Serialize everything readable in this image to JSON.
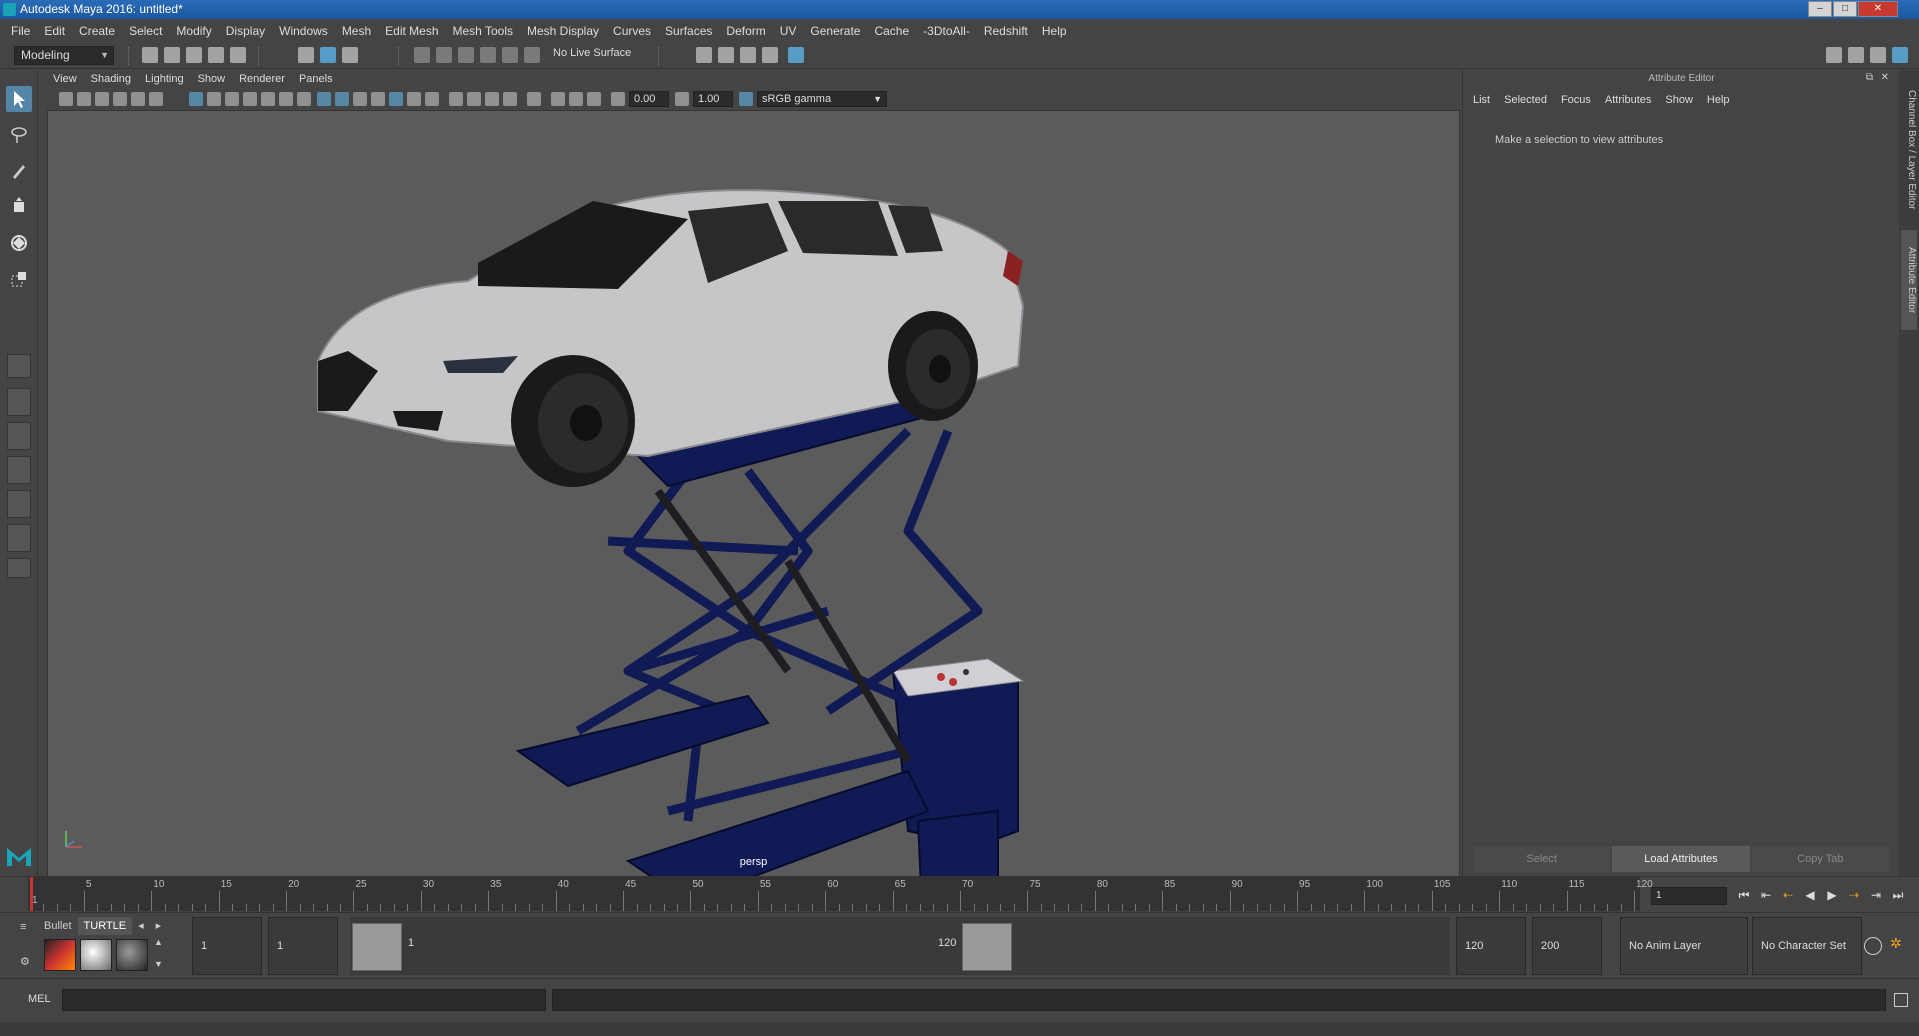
{
  "window": {
    "title": "Autodesk Maya 2016: untitled*"
  },
  "menubar": [
    "File",
    "Edit",
    "Create",
    "Select",
    "Modify",
    "Display",
    "Windows",
    "Mesh",
    "Edit Mesh",
    "Mesh Tools",
    "Mesh Display",
    "Curves",
    "Surfaces",
    "Deform",
    "UV",
    "Generate",
    "Cache",
    "-3DtoAll-",
    "Redshift",
    "Help"
  ],
  "status_line": {
    "mode": "Modeling",
    "live_surface": "No Live Surface"
  },
  "viewport": {
    "menu": [
      "View",
      "Shading",
      "Lighting",
      "Show",
      "Renderer",
      "Panels"
    ],
    "exposure": "0.00",
    "gamma": "1.00",
    "color_space": "sRGB gamma",
    "camera_label": "persp"
  },
  "attribute_editor": {
    "title": "Attribute Editor",
    "menu": [
      "List",
      "Selected",
      "Focus",
      "Attributes",
      "Show",
      "Help"
    ],
    "message": "Make a selection to view attributes",
    "buttons": {
      "select": "Select",
      "load": "Load Attributes",
      "copy": "Copy Tab"
    },
    "side_tabs": {
      "channel_box": "Channel Box / Layer Editor",
      "attribute_editor": "Attribute Editor"
    }
  },
  "timeline": {
    "ticks": [
      "1",
      "5",
      "10",
      "15",
      "20",
      "25",
      "30",
      "35",
      "40",
      "45",
      "50",
      "55",
      "60",
      "65",
      "70",
      "75",
      "80",
      "85",
      "90",
      "95",
      "100",
      "105",
      "110",
      "115",
      "120"
    ],
    "current_frame": "1"
  },
  "range": {
    "shelf_tabs": [
      "Bullet",
      "TURTLE"
    ],
    "start": "1",
    "playback_start": "1",
    "handle_start": "1",
    "handle_end": "120",
    "playback_end": "120",
    "end": "200",
    "anim_layer": "No Anim Layer",
    "character_set": "No Character Set"
  },
  "command_line": {
    "label": "MEL"
  },
  "colors": {
    "accent": "#5285a6",
    "lift": "#101a55",
    "viewport_bg": "#5b5b5b"
  }
}
